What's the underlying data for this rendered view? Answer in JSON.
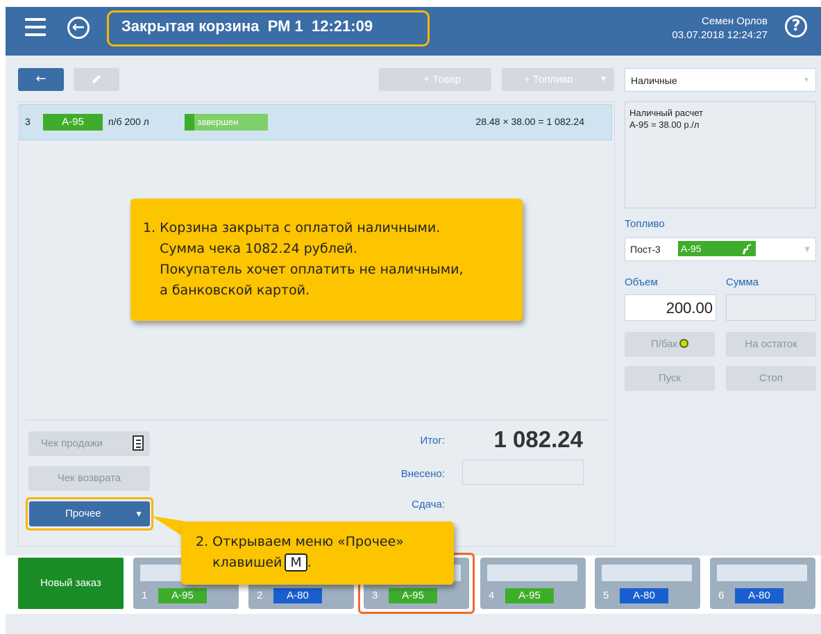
{
  "header": {
    "title": "Закрытая корзина  РМ 1  12:21:09",
    "user_name": "Семен Орлов",
    "datetime": "03.07.2018 12:24:27",
    "back_icon": "arrow-left-circle-icon",
    "menu_icon": "hamburger-icon",
    "help_icon": "question-circle-icon"
  },
  "toolbar": {
    "back_label": "←",
    "edit_icon": "pencil-icon",
    "add_goods_label": "+ Товар",
    "add_fuel_label": "+ Топливо",
    "add_fuel_arrow": "▼"
  },
  "order": {
    "rows": [
      {
        "num": "3",
        "fuel": "А-95",
        "qty": "п/б 200 л",
        "status": "завершен",
        "calc": "28.48 × 38.00 = 1 082.24"
      }
    ]
  },
  "totals": {
    "itog_label": "Итог:",
    "itog_value": "1 082.24",
    "vneseno_label": "Внесено:",
    "vneseno_value": "",
    "sdacha_label": "Сдача:"
  },
  "actions": {
    "check_sale_label": "Чек продажи",
    "check_return_label": "Чек возврата",
    "other_label": "Прочее",
    "other_arrow": "▼"
  },
  "right_panel": {
    "payment_method": "Наличные",
    "payment_info_line1": "Наличный расчет",
    "payment_info_line2": "А-95 = 38.00 р./л",
    "fuel_label": "Топливо",
    "fuel_post": "Пост-3",
    "fuel_grade": "А-95",
    "volume_label": "Объем",
    "sum_label": "Сумма",
    "volume_value": "200.00",
    "sum_value": "",
    "full_tank_label": "П/бак",
    "remainder_label": "На остаток",
    "start_label": "Пуск",
    "stop_label": "Стоп"
  },
  "bottom": {
    "new_order_label": "Новый заказ",
    "tabs": [
      {
        "num": "1",
        "fuel": "А-95"
      },
      {
        "num": "2",
        "fuel": "А-80"
      },
      {
        "num": "3",
        "fuel": "А-95"
      },
      {
        "num": "4",
        "fuel": "А-95"
      },
      {
        "num": "5",
        "fuel": "А-80"
      },
      {
        "num": "6",
        "fuel": "А-80"
      }
    ]
  },
  "callouts": {
    "c1_text": "1. Корзина закрыта с оплатой наличными.\n    Сумма чека 1082.24 рублей.\n    Покупатель хочет оплатить не наличными,\n    а банковской картой.",
    "c2_line1": "2. Открываем меню «Прочее»",
    "c2_line2": "    клавишей",
    "c2_key": "M",
    "c2_end": "."
  },
  "colors": {
    "header_bg": "#3b6da6",
    "highlight_outline": "#f7b500",
    "active_tab_outline": "#f06a2c",
    "callout_bg": "#fdc400",
    "fuel_a95": "#3fad2b",
    "fuel_a80": "#1a5fd0"
  }
}
